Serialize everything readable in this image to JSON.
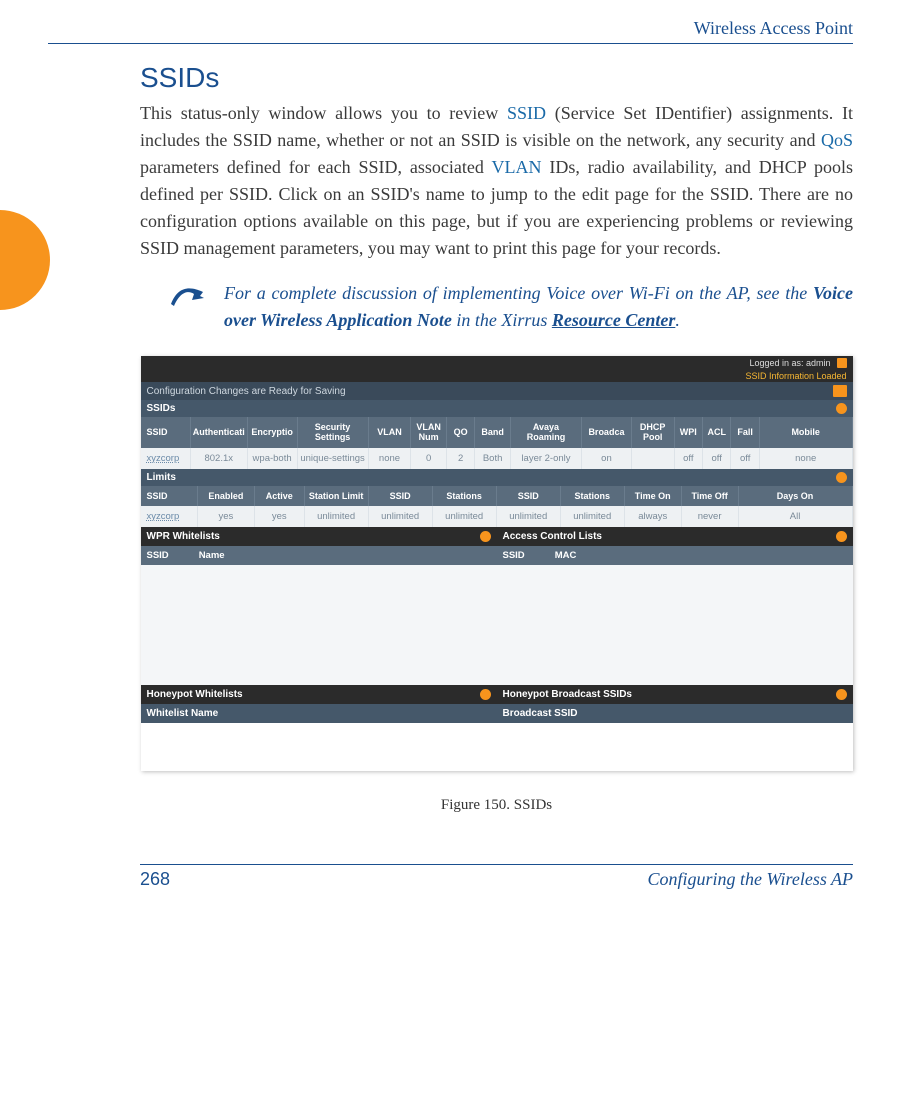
{
  "header": {
    "title": "Wireless Access Point"
  },
  "section": {
    "title": "SSIDs"
  },
  "body": {
    "t1": "This status-only window allows you to review ",
    "link1": "SSID",
    "t2": " (Service Set IDentifier) assignments. It includes the SSID name, whether or not an SSID is visible on the network, any security and ",
    "link2": "QoS",
    "t3": " parameters defined for each SSID, associated ",
    "link3": "VLAN",
    "t4": " IDs, radio availability, and DHCP pools defined per SSID. Click on an SSID's name to jump to the edit page for the SSID. There are no configuration options available on this page, but if you are experiencing problems or reviewing SSID management parameters, you may want to print this page for your records."
  },
  "note": {
    "t1": "For a complete discussion of implementing Voice over Wi-Fi on the AP, see the ",
    "bold1": "Voice over Wireless Application Note",
    "t2": " in the Xirrus ",
    "underline1": "Resource Center",
    "t3": "."
  },
  "screenshot": {
    "logged_in": "Logged in as: admin",
    "loaded": "SSID Information Loaded",
    "savebar": "Configuration Changes are Ready for Saving",
    "sec_ssids": "SSIDs",
    "ssids_headers": [
      "SSID",
      "Authenticati",
      "Encryptio",
      "Security Settings",
      "VLAN",
      "VLAN Num",
      "QO",
      "Band",
      "Avaya Roaming",
      "Broadca",
      "DHCP Pool",
      "WPI",
      "ACL",
      "Fall",
      "Mobile"
    ],
    "ssids_row": [
      "xyzcorp",
      "802.1x",
      "wpa-both",
      "unique-settings",
      "none",
      "0",
      "2",
      "Both",
      "layer 2-only",
      "on",
      "",
      "off",
      "off",
      "off",
      "none"
    ],
    "sec_limits": "Limits",
    "limits_headers": [
      "SSID",
      "Enabled",
      "Active",
      "Station Limit",
      "SSID",
      "Stations",
      "SSID",
      "Stations",
      "Time On",
      "Time Off",
      "Days On"
    ],
    "limits_row": [
      "xyzcorp",
      "yes",
      "yes",
      "unlimited",
      "unlimited",
      "unlimited",
      "unlimited",
      "unlimited",
      "always",
      "never",
      "All"
    ],
    "wpr": "WPR Whitelists",
    "wpr_headers_ssid": "SSID",
    "wpr_headers_name": "Name",
    "acl": "Access Control Lists",
    "acl_headers_ssid": "SSID",
    "acl_headers_mac": "MAC",
    "honeypot_wl": "Honeypot Whitelists",
    "honeypot_wl_sub": "Whitelist Name",
    "honeypot_bc": "Honeypot Broadcast SSIDs",
    "honeypot_bc_sub": "Broadcast SSID"
  },
  "caption": "Figure 150. SSIDs",
  "footer": {
    "page": "268",
    "chapter": "Configuring the Wireless AP"
  }
}
